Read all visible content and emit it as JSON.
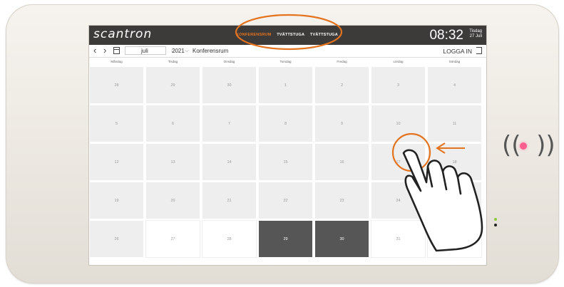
{
  "header": {
    "logo": "scantron",
    "tabs": [
      {
        "label": "KONFERENSRUM",
        "active": true
      },
      {
        "label": "TVÄTTSTUGA",
        "active": false
      },
      {
        "label": "TVÄTTSTUGA",
        "active": false
      }
    ],
    "time": "08:32",
    "weekday": "Tisdag",
    "date": "27 Juli"
  },
  "toolbar": {
    "prev": "‹",
    "next": "›",
    "month": "juli",
    "year": "2021",
    "room": "Konferensrum",
    "login": "LOGGA IN"
  },
  "weekdays": [
    "Måndag",
    "Tisdag",
    "Onsdag",
    "Torsdag",
    "Fredag",
    "Lördag",
    "Söndag"
  ],
  "weeks": [
    [
      "28",
      "29",
      "30",
      "1",
      "2",
      "3",
      "4"
    ],
    [
      "5",
      "6",
      "7",
      "8",
      "9",
      "10",
      "11"
    ],
    [
      "12",
      "13",
      "14",
      "15",
      "16",
      "17",
      "18"
    ],
    [
      "19",
      "20",
      "21",
      "22",
      "23",
      "24",
      "25"
    ],
    [
      "26",
      "27",
      "28",
      "29",
      "30",
      "31",
      "1"
    ]
  ],
  "colors": {
    "accent": "#e3731e",
    "topbar": "#3d3a3a",
    "booked": "#565656",
    "past": "#eeeeee"
  },
  "icons": {
    "calendar": "calendar-icon",
    "login": "login-arrow-icon",
    "nfc": "nfc-reader-icon",
    "hand": "pointing-hand-icon"
  }
}
